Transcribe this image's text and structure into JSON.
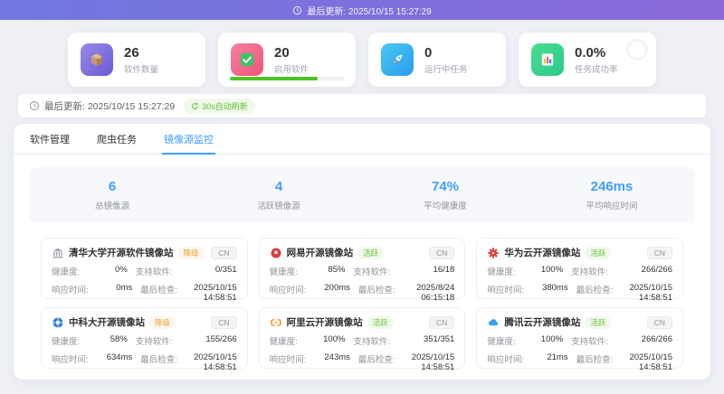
{
  "colors": {
    "primary_blue": "#409eff",
    "success_green": "#67c23a",
    "warning_orange": "#e6a23c",
    "progress_green": "#4cc421",
    "banner_gradient_start": "#7178e0",
    "banner_gradient_end": "#8a68d8"
  },
  "top_banner": {
    "text": "最后更新: 2025/10/15 15:27:29"
  },
  "stat_cards": [
    {
      "value": "26",
      "label": "软件数量"
    },
    {
      "value": "20",
      "label": "启用软件",
      "progress_percent": 77,
      "progress_style": "width:77%"
    },
    {
      "value": "0",
      "label": "运行中任务"
    },
    {
      "value": "0.0%",
      "label": "任务成功率"
    }
  ],
  "refresh_bar": {
    "text": "最后更新: 2025/10/15 15:27:29",
    "badge": "30s自动刷新"
  },
  "tabs": [
    {
      "label": "软件管理",
      "active": false
    },
    {
      "label": "爬虫任务",
      "active": false
    },
    {
      "label": "镜像源监控",
      "active": true
    }
  ],
  "summary": [
    {
      "value": "6",
      "label": "总镜像源"
    },
    {
      "value": "4",
      "label": "活跃镜像源"
    },
    {
      "value": "74%",
      "label": "平均健康度"
    },
    {
      "value": "246ms",
      "label": "平均响应时间"
    }
  ],
  "field_labels": {
    "health": "健康度:",
    "software": "支持软件:",
    "response": "响应时间:",
    "check": "最后检查:"
  },
  "mirrors": [
    {
      "name": "清华大学开源软件镜像站",
      "status": "降级",
      "region": "CN",
      "health": "0%",
      "software": "0/351",
      "response": "0ms",
      "check": "2025/10/15 14:58:51"
    },
    {
      "name": "网易开源镜像站",
      "status": "活跃",
      "region": "CN",
      "health": "85%",
      "software": "16/18",
      "response": "200ms",
      "check": "2025/8/24 06:15:18"
    },
    {
      "name": "华为云开源镜像站",
      "status": "活跃",
      "region": "CN",
      "health": "100%",
      "software": "266/266",
      "response": "380ms",
      "check": "2025/10/15 14:58:51"
    },
    {
      "name": "中科大开源镜像站",
      "status": "降级",
      "region": "CN",
      "health": "58%",
      "software": "155/266",
      "response": "634ms",
      "check": "2025/10/15 14:58:51"
    },
    {
      "name": "阿里云开源镜像站",
      "status": "活跃",
      "region": "CN",
      "health": "100%",
      "software": "351/351",
      "response": "243ms",
      "check": "2025/10/15 14:58:51"
    },
    {
      "name": "腾讯云开源镜像站",
      "status": "活跃",
      "region": "CN",
      "health": "100%",
      "software": "266/266",
      "response": "21ms",
      "check": "2025/10/15 14:58:51"
    }
  ]
}
